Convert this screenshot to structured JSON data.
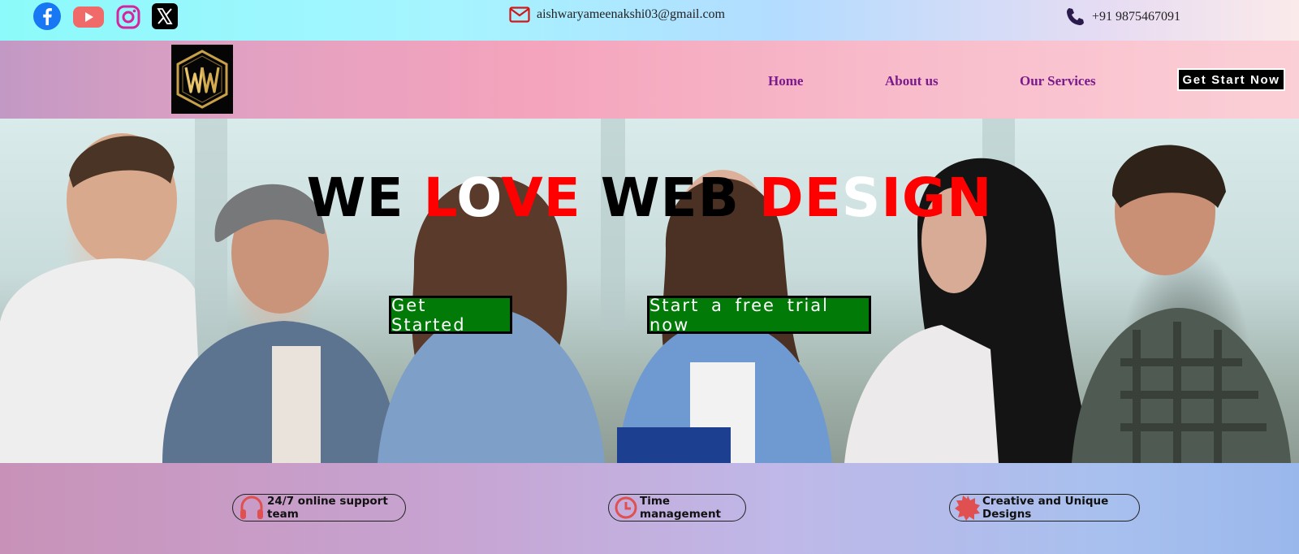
{
  "topbar": {
    "social": [
      "facebook-icon",
      "youtube-icon",
      "instagram-icon",
      "x-icon"
    ],
    "email": "aishwaryameenakshi03@gmail.com",
    "phone": "+91 9875467091"
  },
  "nav": {
    "logo_text": "WW",
    "links": [
      "Home",
      "About us",
      "Our Services"
    ],
    "cta": "Get Start Now"
  },
  "hero": {
    "title_parts": [
      {
        "text": "WE ",
        "color": "#000000"
      },
      {
        "text": "L",
        "color": "#ff0000"
      },
      {
        "text": "O",
        "color": "#ffffff"
      },
      {
        "text": "VE",
        "color": "#ff0000"
      },
      {
        "text": " WEB ",
        "color": "#000000"
      },
      {
        "text": "DE",
        "color": "#ff0000"
      },
      {
        "text": "S",
        "color": "#ffffff"
      },
      {
        "text": "IGN",
        "color": "#ff0000"
      }
    ],
    "buttons": [
      "Get Started",
      "Start a free trial now"
    ]
  },
  "features": [
    {
      "icon": "headphones-icon",
      "label": "24/7 online support team"
    },
    {
      "icon": "clock-icon",
      "label": "Time management"
    },
    {
      "icon": "badge-icon",
      "label": "Creative and Unique Designs"
    }
  ],
  "colors": {
    "accent_green": "#017a07",
    "nav_link": "#7a1a8c",
    "icon_red": "#e03a3a",
    "logo_gold": "#c9a04a"
  }
}
